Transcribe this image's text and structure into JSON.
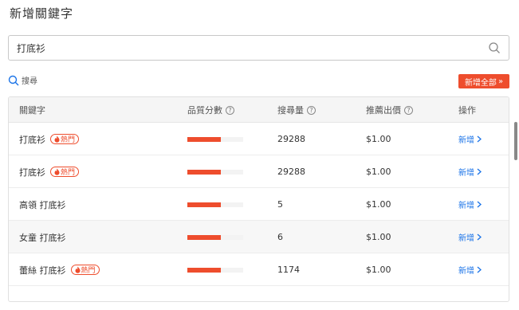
{
  "page": {
    "title": "新增關鍵字"
  },
  "search": {
    "value": "打底衫",
    "link_label": "搜尋"
  },
  "add_all": {
    "label": "新增全部",
    "arrow": "»"
  },
  "table": {
    "headers": {
      "keyword": "關鍵字",
      "quality": "品質分數",
      "volume": "搜尋量",
      "bid": "推薦出價",
      "action": "操作"
    },
    "hot_label": "熱門",
    "add_label": "新增",
    "rows": [
      {
        "keyword": "打底衫",
        "hot": true,
        "quality": 0.6,
        "volume": "29288",
        "bid": "$1.00"
      },
      {
        "keyword": "打底衫",
        "hot": true,
        "quality": 0.6,
        "volume": "29288",
        "bid": "$1.00"
      },
      {
        "keyword": "高領 打底衫",
        "hot": false,
        "quality": 0.6,
        "volume": "5",
        "bid": "$1.00"
      },
      {
        "keyword": "女童 打底衫",
        "hot": false,
        "quality": 0.6,
        "volume": "6",
        "bid": "$1.00",
        "highlighted": true
      },
      {
        "keyword": "蕾絲 打底衫",
        "hot": true,
        "quality": 0.6,
        "volume": "1174",
        "bid": "$1.00"
      }
    ]
  },
  "colors": {
    "accent": "#ee4d2d",
    "link": "#1a73e8"
  }
}
